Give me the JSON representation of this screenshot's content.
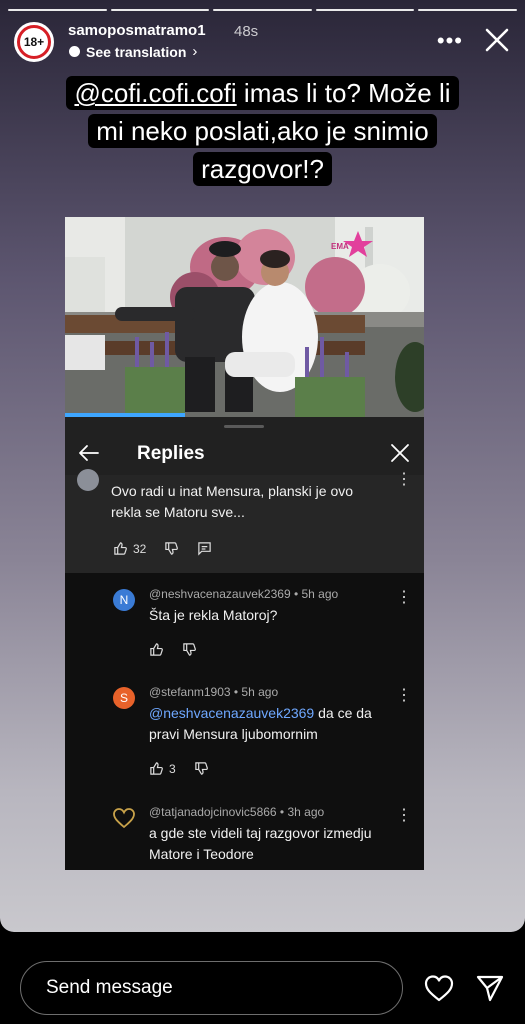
{
  "story": {
    "username": "samoposmatramo1",
    "time": "48s",
    "see_translation": "See translation",
    "avatar_badge": "18+"
  },
  "caption": {
    "line1_mention": "@cofi.cofi.cofi",
    "line1_rest": " imas li to? Može li",
    "line2": "mi neko poslati,ako je snimio",
    "line3": "razgovor!?"
  },
  "replies": {
    "title": "Replies",
    "parent": {
      "text_line1": "Ovo radi u inat Mensura, planski je ovo",
      "text_line2": "rekla se Matoru sve...",
      "likes": "32"
    },
    "items": [
      {
        "avatar_letter": "N",
        "handle": "@neshvacenazauvek2369 • 5h ago",
        "text": "Šta je rekla Matoroj?",
        "likes": ""
      },
      {
        "avatar_letter": "S",
        "handle": "@stefanm1903 • 5h ago",
        "mention": "@neshvacenazauvek2369",
        "text_rest": " da ce da",
        "text_line2": "pravi Mensura ljubomornim",
        "likes": "3"
      },
      {
        "handle": "@tatjanadojcinovic5866 • 3h ago",
        "text_line1": "a gde ste videli taj razgovor izmedju",
        "text_line2": "Matore i Teodore"
      }
    ]
  },
  "video": {
    "logo_text": "EMA"
  },
  "bottom": {
    "send_placeholder": "Send message"
  },
  "colors": {
    "reply_avatar_n": "#3a7bd5",
    "reply_avatar_s": "#e8622a",
    "mention": "#6fa8ff",
    "badge_ring": "#d61f26"
  }
}
